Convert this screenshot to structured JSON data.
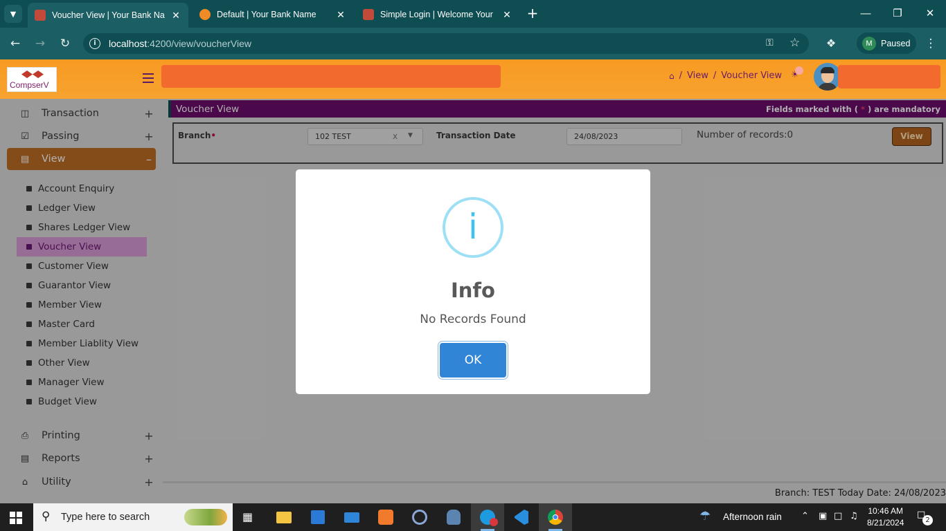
{
  "browser": {
    "tabs": [
      {
        "title": "Voucher View | Your Bank Name",
        "active": true
      },
      {
        "title": "Default | Your Bank Name",
        "active": false
      },
      {
        "title": "Simple Login | Welcome Your Ba",
        "active": false
      }
    ],
    "url_host": "localhost",
    "url_rest": ":4200/view/voucherView",
    "profile_initial": "M",
    "profile_status": "Paused"
  },
  "header": {
    "logo_text": "CompserV",
    "breadcrumb": [
      "View",
      "Voucher View"
    ]
  },
  "sidebar": {
    "menus_top": [
      {
        "label": "Transaction",
        "icon": "money-icon",
        "toggle": "+"
      },
      {
        "label": "Passing",
        "icon": "check-square-icon",
        "toggle": "+"
      },
      {
        "label": "View",
        "icon": "book-icon",
        "toggle": "–"
      }
    ],
    "view_items": [
      "Account Enquiry",
      "Ledger View",
      "Shares Ledger View",
      "Voucher View",
      "Customer View",
      "Guarantor View",
      "Member View",
      "Master Card",
      "Member Liablity View",
      "Other View",
      "Manager View",
      "Budget View"
    ],
    "active_item": "Voucher View",
    "menus_bottom": [
      {
        "label": "Printing",
        "icon": "print-icon",
        "toggle": "+"
      },
      {
        "label": "Reports",
        "icon": "file-icon",
        "toggle": "+"
      },
      {
        "label": "Utility",
        "icon": "bank-icon",
        "toggle": "+"
      }
    ]
  },
  "page": {
    "title": "Voucher View",
    "mandatory_prefix": "Fields marked with (",
    "mandatory_star": "*",
    "mandatory_suffix": ") are mandatory",
    "branch_label": "Branch",
    "branch_value": "102 TEST",
    "clear_symbol": "x",
    "date_label": "Transaction Date",
    "date_value": "24/08/2023",
    "records_text": "Number of records:0",
    "view_button": "View",
    "status_text": "Branch: TEST Today Date: 24/08/2023"
  },
  "modal": {
    "icon_glyph": "i",
    "title": "Info",
    "message": "No Records Found",
    "ok_label": "OK"
  },
  "taskbar": {
    "search_placeholder": "Type here to search",
    "weather": "Afternoon rain",
    "time": "10:46 AM",
    "date": "8/21/2024",
    "notification_count": "2"
  },
  "colors": {
    "header_orange": "#f79a22",
    "view_menu_active": "#bd6d24",
    "title_bar_purple": "#6c0e6c",
    "ok_blue": "#3085d6",
    "info_cyan": "#3fc3ee"
  }
}
